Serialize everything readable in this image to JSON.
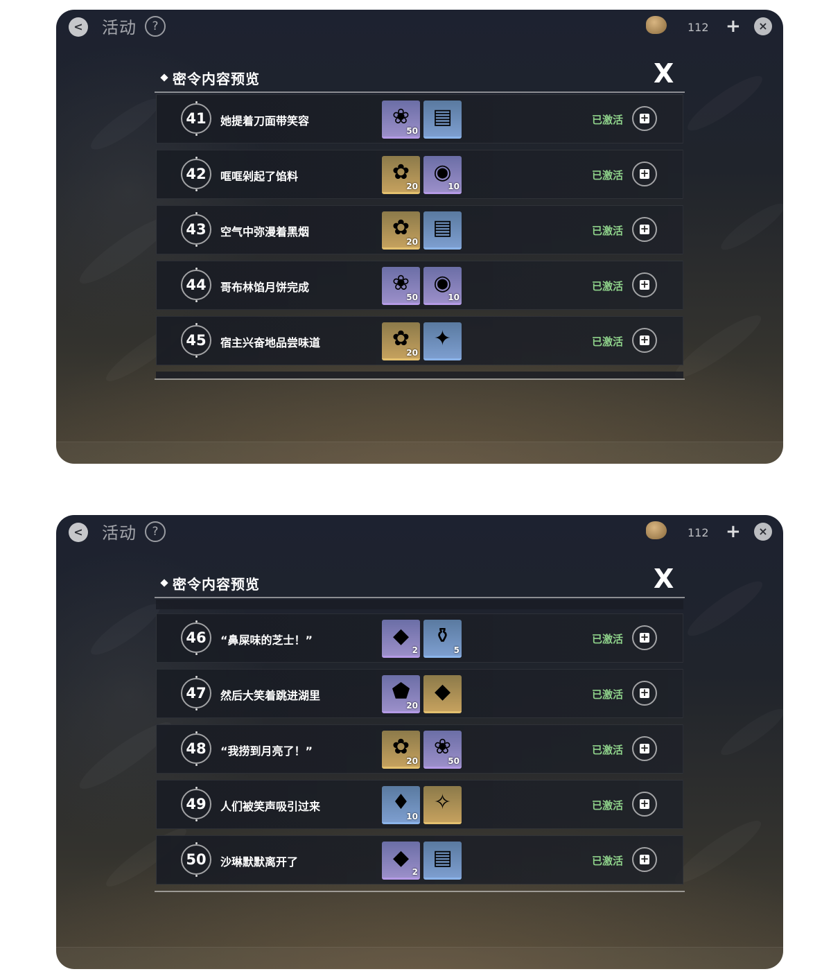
{
  "topbar": {
    "title": "活动",
    "help_glyph": "?",
    "back_glyph": "<",
    "currency_count": "112",
    "plus_glyph": "+",
    "close_glyph": "×"
  },
  "panel": {
    "title": "密令内容预览",
    "close_glyph": "X"
  },
  "screenshots": [
    {
      "rows": [
        {
          "num": "41",
          "title": "她提着刀面带笑容",
          "status": "已激活",
          "items": [
            {
              "icon": "flower-vase-icon",
              "glyph": "❀",
              "qty": "50",
              "color": "purple"
            },
            {
              "icon": "book-icon",
              "glyph": "▤",
              "qty": "",
              "color": "blue"
            }
          ]
        },
        {
          "num": "42",
          "title": "哐哐剁起了馅料",
          "status": "已激活",
          "items": [
            {
              "icon": "gold-drop-icon",
              "glyph": "✿",
              "qty": "20",
              "color": "gold"
            },
            {
              "icon": "crystal-orb-icon",
              "glyph": "◉",
              "qty": "10",
              "color": "purple"
            }
          ]
        },
        {
          "num": "43",
          "title": "空气中弥漫着黑烟",
          "status": "已激活",
          "items": [
            {
              "icon": "gold-drop-icon",
              "glyph": "✿",
              "qty": "20",
              "color": "gold"
            },
            {
              "icon": "book-icon",
              "glyph": "▤",
              "qty": "",
              "color": "blue"
            }
          ]
        },
        {
          "num": "44",
          "title": "哥布林馅月饼完成",
          "status": "已激活",
          "items": [
            {
              "icon": "flower-vase-icon",
              "glyph": "❀",
              "qty": "50",
              "color": "purple"
            },
            {
              "icon": "gold-orb-icon",
              "glyph": "◉",
              "qty": "10",
              "color": "purple"
            }
          ]
        },
        {
          "num": "45",
          "title": "宿主兴奋地品尝味道",
          "status": "已激活",
          "items": [
            {
              "icon": "gold-drop-icon",
              "glyph": "✿",
              "qty": "20",
              "color": "gold"
            },
            {
              "icon": "rainbow-feather-icon",
              "glyph": "✦",
              "qty": "",
              "color": "blue"
            }
          ]
        }
      ]
    },
    {
      "rows": [
        {
          "num": "46",
          "title": "“鼻屎味的芝士！”",
          "status": "已激活",
          "items": [
            {
              "icon": "purple-puzzle-icon",
              "glyph": "◆",
              "qty": "2",
              "color": "purple"
            },
            {
              "icon": "jar-icon",
              "glyph": "⚱",
              "qty": "5",
              "color": "blue"
            }
          ]
        },
        {
          "num": "47",
          "title": "然后大笑着跳进湖里",
          "status": "已激活",
          "items": [
            {
              "icon": "amber-crystal-icon",
              "glyph": "⬟",
              "qty": "20",
              "color": "purple"
            },
            {
              "icon": "gold-puzzle-icon",
              "glyph": "◆",
              "qty": "",
              "color": "gold"
            }
          ]
        },
        {
          "num": "48",
          "title": "“我捞到月亮了！”",
          "status": "已激活",
          "items": [
            {
              "icon": "gold-drop-icon",
              "glyph": "✿",
              "qty": "20",
              "color": "gold"
            },
            {
              "icon": "flower-vase-icon",
              "glyph": "❀",
              "qty": "50",
              "color": "purple"
            }
          ]
        },
        {
          "num": "49",
          "title": "人们被笑声吸引过来",
          "status": "已激活",
          "items": [
            {
              "icon": "blue-crystal-icon",
              "glyph": "♦",
              "qty": "10",
              "color": "blue"
            },
            {
              "icon": "rainbow-card-icon",
              "glyph": "✧",
              "qty": "",
              "color": "gold"
            }
          ]
        },
        {
          "num": "50",
          "title": "沙琳默默离开了",
          "status": "已激活",
          "items": [
            {
              "icon": "purple-puzzle-icon",
              "glyph": "◆",
              "qty": "2",
              "color": "purple"
            },
            {
              "icon": "book-icon",
              "glyph": "▤",
              "qty": "",
              "color": "blue"
            }
          ]
        }
      ]
    }
  ]
}
